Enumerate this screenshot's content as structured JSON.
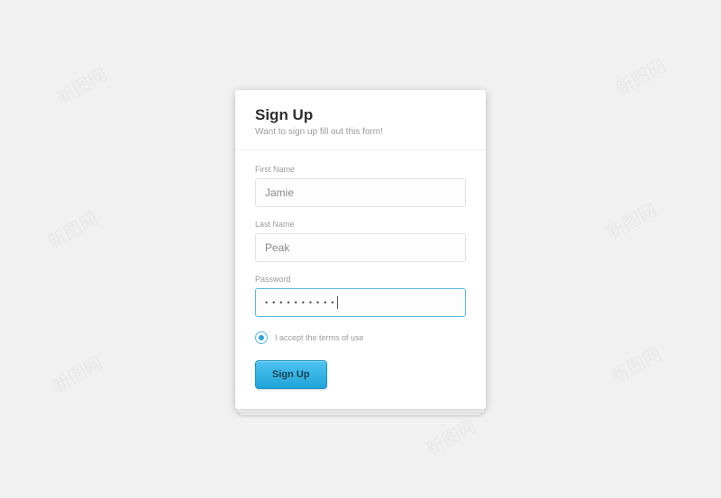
{
  "header": {
    "title": "Sign Up",
    "subtitle": "Want to sign up fill out this form!"
  },
  "fields": {
    "first_name": {
      "label": "First Name",
      "value": "Jamie"
    },
    "last_name": {
      "label": "Last Name",
      "value": "Peak"
    },
    "password": {
      "label": "Password",
      "value": "••••••••••"
    }
  },
  "terms": {
    "label": "I accept the terms of use",
    "checked": true
  },
  "submit": {
    "label": "Sign Up"
  },
  "watermark_text": "新图网"
}
